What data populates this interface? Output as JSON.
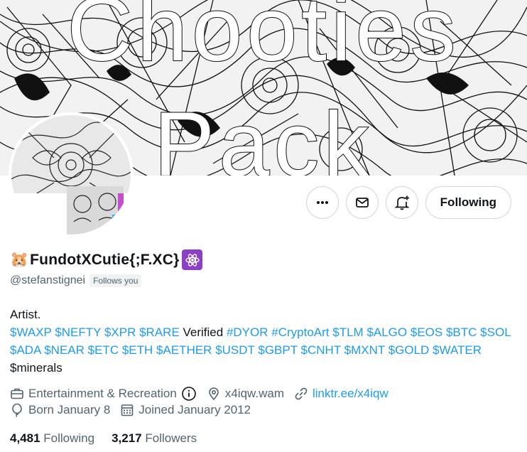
{
  "banner": {
    "line1": "Chooties",
    "line2": "Pack"
  },
  "actions": {
    "more_icon": "more-icon",
    "message_icon": "mail-icon",
    "notify_icon": "bell-plus-icon",
    "follow_label": "Following"
  },
  "profile": {
    "name": "FundotXCutie{;F.XC}",
    "name_emoji": "🐹",
    "badge_icon": "atom-icon",
    "handle": "@stefanstignei",
    "follows_you": "Follows you"
  },
  "bio": {
    "line_artist": "Artist.",
    "segments": [
      {
        "text": "$WAXP",
        "link": true
      },
      {
        "text": " ",
        "link": false
      },
      {
        "text": "$NEFTY",
        "link": true
      },
      {
        "text": " ",
        "link": false
      },
      {
        "text": "$XPR",
        "link": true
      },
      {
        "text": " ",
        "link": false
      },
      {
        "text": "$RARE",
        "link": true
      },
      {
        "text": " Verified ",
        "link": false
      },
      {
        "text": "#DYOR",
        "link": true
      },
      {
        "text": " ",
        "link": false
      },
      {
        "text": "#CryptoArt",
        "link": true
      },
      {
        "text": " ",
        "link": false
      },
      {
        "text": "$TLM",
        "link": true
      },
      {
        "text": " ",
        "link": false
      },
      {
        "text": "$ALGO",
        "link": true
      },
      {
        "text": " ",
        "link": false
      },
      {
        "text": "$EOS",
        "link": true
      },
      {
        "text": " ",
        "link": false
      },
      {
        "text": "$BTC",
        "link": true
      },
      {
        "text": " ",
        "link": false
      },
      {
        "text": "$SOL",
        "link": true
      },
      {
        "text": " ",
        "link": false
      },
      {
        "text": "$ADA",
        "link": true
      },
      {
        "text": " ",
        "link": false
      },
      {
        "text": "$NEAR",
        "link": true
      },
      {
        "text": " ",
        "link": false
      },
      {
        "text": "$ETC",
        "link": true
      },
      {
        "text": " ",
        "link": false
      },
      {
        "text": "$ETH",
        "link": true
      },
      {
        "text": " ",
        "link": false
      },
      {
        "text": "$AETHER",
        "link": true
      },
      {
        "text": " ",
        "link": false
      },
      {
        "text": "$USDT",
        "link": true
      },
      {
        "text": " ",
        "link": false
      },
      {
        "text": "$GBPT",
        "link": true
      },
      {
        "text": " ",
        "link": false
      },
      {
        "text": "$CNHT",
        "link": true
      },
      {
        "text": " ",
        "link": false
      },
      {
        "text": "$MXNT",
        "link": true
      },
      {
        "text": " ",
        "link": false
      },
      {
        "text": "$GOLD",
        "link": true
      },
      {
        "text": " ",
        "link": false
      },
      {
        "text": "$WATER",
        "link": true
      },
      {
        "text": " $minerals",
        "link": false
      }
    ]
  },
  "meta": {
    "category": "Entertainment & Recreation",
    "category_icon": "briefcase-icon",
    "info_icon": "info-icon",
    "location": "x4iqw.wam",
    "location_icon": "location-pin-icon",
    "website": "linktr.ee/x4iqw",
    "website_icon": "link-icon",
    "born": "Born January 8",
    "born_icon": "balloon-icon",
    "joined": "Joined January 2012",
    "joined_icon": "calendar-icon"
  },
  "stats": {
    "following_count": "4,481",
    "following_label": "Following",
    "followers_count": "3,217",
    "followers_label": "Followers"
  },
  "colors": {
    "link": "#1d9bf0",
    "muted": "#536471",
    "text": "#0f1419",
    "badge": "#8b41c7",
    "border": "#cfd9de"
  }
}
